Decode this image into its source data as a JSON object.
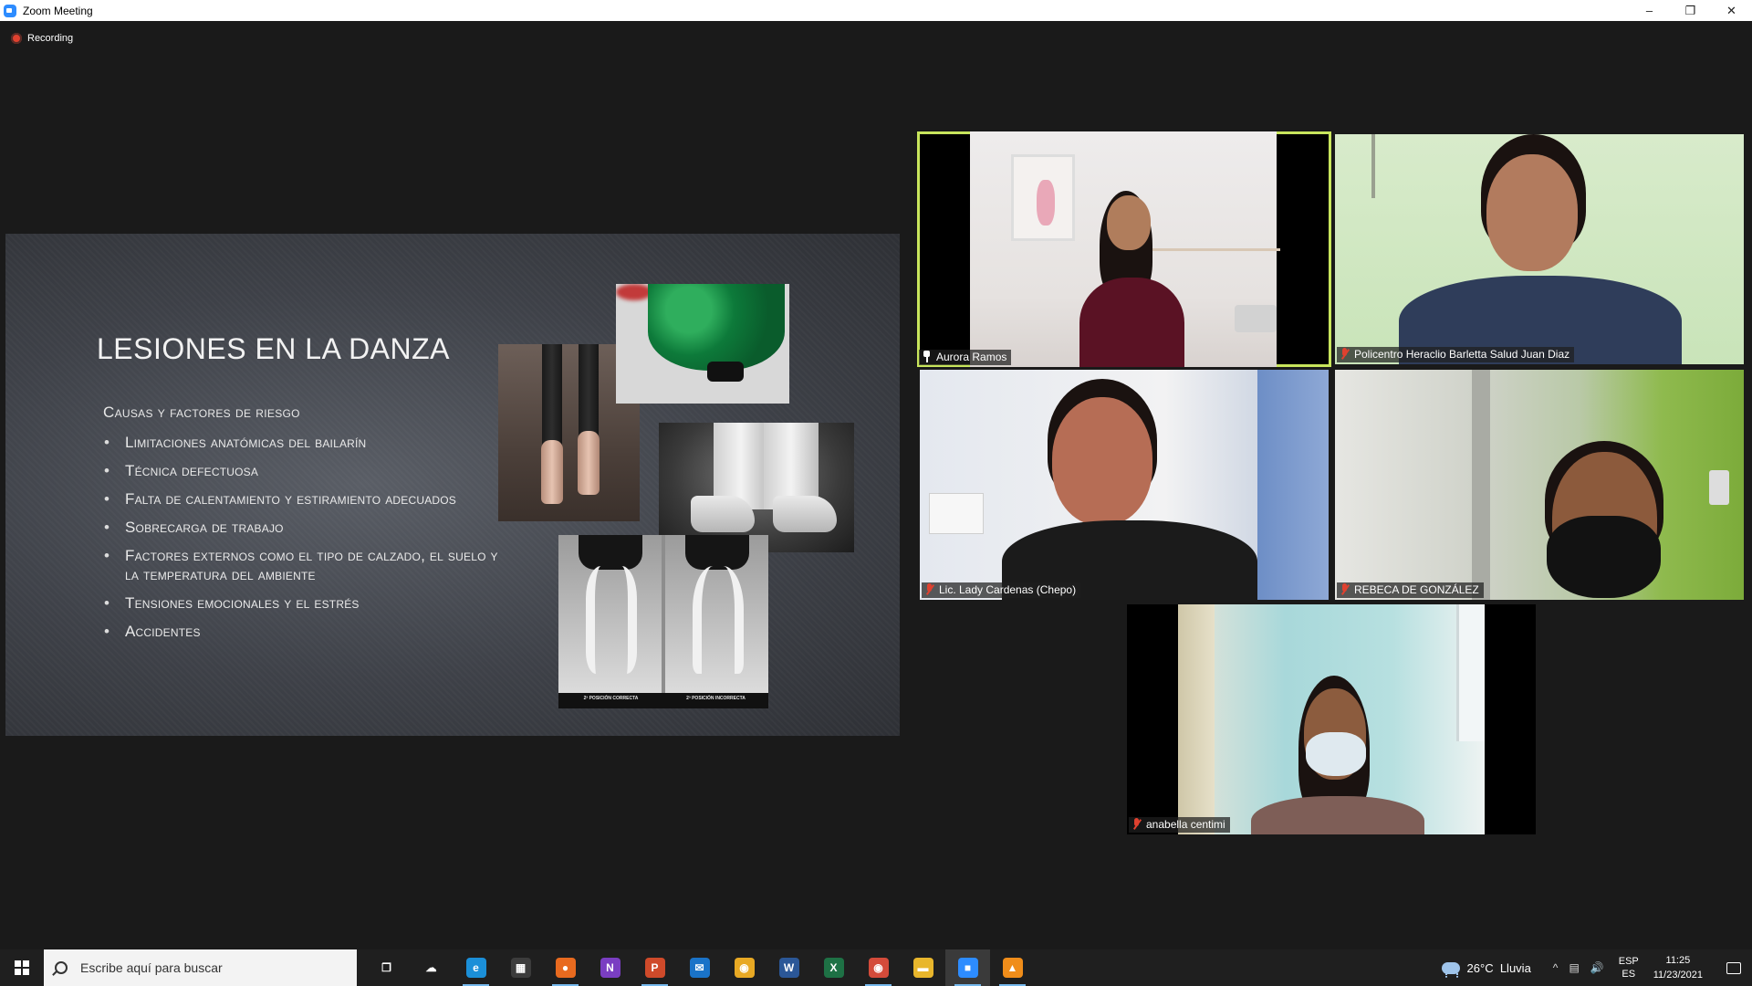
{
  "window": {
    "title": "Zoom Meeting",
    "minimize": "–",
    "restore": "❐",
    "close": "✕"
  },
  "recording": {
    "label": "Recording",
    "color": "#e0412f"
  },
  "slide": {
    "title": "LESIONES EN LA DANZA",
    "subtitle": "Causas y factores de riesgo",
    "bullets": [
      "Limitaciones anatómicas del bailarín",
      "Técnica defectuosa",
      "Falta de calentamiento y estiramiento adecuados",
      "Sobrecarga de trabajo",
      "Factores externos como el tipo de calzado, el suelo y la temperatura del ambiente",
      "Tensiones emocionales y el estrés",
      "Accidentes"
    ],
    "bullet_glyph": "•",
    "photo_captions": [
      "2ª POSICIÓN CORRECTA",
      "2ª POSICIÓN INCORRECTA"
    ]
  },
  "participants": [
    {
      "name": "Aurora Ramos",
      "status_icon": "pin-icon",
      "active_speaker": true
    },
    {
      "name": "Policentro Heraclio Barletta Salud Juan Diaz",
      "status_icon": "mic-muted-icon",
      "active_speaker": false
    },
    {
      "name": "Lic. Lady Cardenas (Chepo)",
      "status_icon": "mic-muted-icon",
      "active_speaker": false
    },
    {
      "name": "REBECA DE GONZÁLEZ",
      "status_icon": "mic-muted-icon",
      "active_speaker": false
    },
    {
      "name": "anabella centimi",
      "status_icon": "mic-muted-icon",
      "active_speaker": false
    }
  ],
  "colors": {
    "active_speaker_border": "#c8e55c",
    "taskbar": "#1f1f1f",
    "accent": "#2d8cff"
  },
  "taskbar": {
    "search_placeholder": "Escribe aquí para buscar",
    "apps": [
      {
        "name": "task-view-icon",
        "glyph": "❐",
        "color": "transparent"
      },
      {
        "name": "weather-news-icon",
        "glyph": "☁",
        "color": "transparent"
      },
      {
        "name": "edge-icon",
        "glyph": "e",
        "color": "#1b8fd8"
      },
      {
        "name": "store-icon",
        "glyph": "▦",
        "color": "#3c3c3c"
      },
      {
        "name": "firefox-icon",
        "glyph": "●",
        "color": "#e86a1f"
      },
      {
        "name": "onenote-icon",
        "glyph": "N",
        "color": "#7a3ec2"
      },
      {
        "name": "powerpoint-icon",
        "glyph": "P",
        "color": "#cf4a2a"
      },
      {
        "name": "mail-icon",
        "glyph": "✉",
        "color": "#1a73c8"
      },
      {
        "name": "chrome-icon",
        "glyph": "◉",
        "color": "#e8a924"
      },
      {
        "name": "word-icon",
        "glyph": "W",
        "color": "#2b5797"
      },
      {
        "name": "excel-icon",
        "glyph": "X",
        "color": "#1e7145"
      },
      {
        "name": "chrome-profile-icon",
        "glyph": "◉",
        "color": "#d44b3a"
      },
      {
        "name": "file-explorer-icon",
        "glyph": "▬",
        "color": "#e8b62c"
      },
      {
        "name": "zoom-icon",
        "glyph": "■",
        "color": "#2d8cff"
      },
      {
        "name": "vlc-icon",
        "glyph": "▲",
        "color": "#f08d1a"
      }
    ],
    "weather": {
      "temp": "26°C",
      "condition": "Lluvia"
    },
    "tray_chevron": "^",
    "language": {
      "line1": "ESP",
      "line2": "ES"
    },
    "clock": {
      "time": "11:25",
      "date": "11/23/2021"
    }
  }
}
